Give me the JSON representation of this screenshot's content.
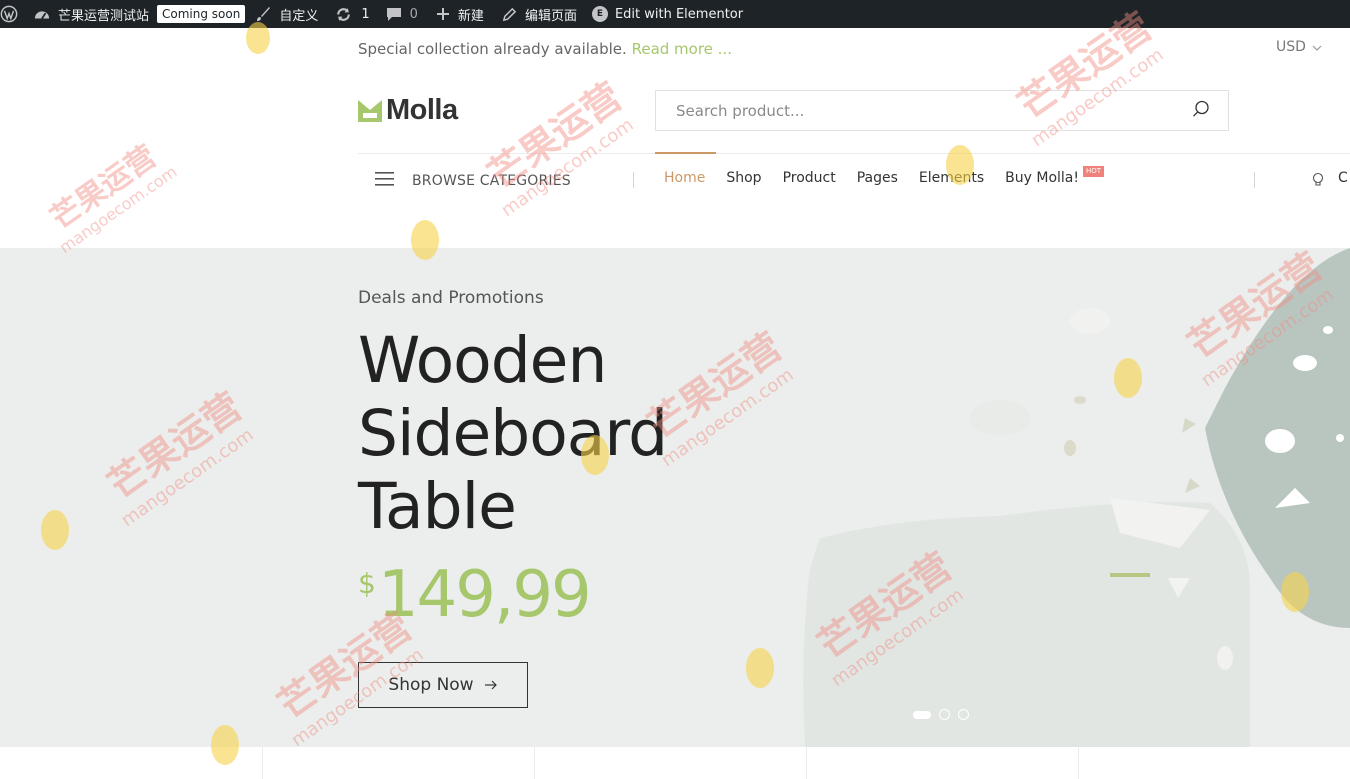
{
  "admin_bar": {
    "site_name": "芒果运营测试站",
    "coming_soon": "Coming soon",
    "customize": "自定义",
    "updates_count": "1",
    "comments_count": "0",
    "new": "新建",
    "edit_page": "编辑页面",
    "edit_elementor": "Edit with Elementor"
  },
  "topbar": {
    "message": "Special collection already available.",
    "read_more": "Read more ...",
    "currency": "USD"
  },
  "header": {
    "logo_text": "Molla",
    "search_placeholder": "Search product..."
  },
  "nav": {
    "browse_label": "BROWSE CATEGORIES",
    "items": [
      {
        "label": "Home",
        "active": true
      },
      {
        "label": "Shop"
      },
      {
        "label": "Product"
      },
      {
        "label": "Pages"
      },
      {
        "label": "Elements"
      },
      {
        "label": "Buy Molla!"
      }
    ],
    "hot_badge": "HOT",
    "right_partial": "C"
  },
  "hero": {
    "subtitle": "Deals and Promotions",
    "title_lines": [
      "Wooden",
      "Sideboard",
      "Table"
    ],
    "price_currency": "$",
    "price_amount": "149,99",
    "cta": "Shop Now",
    "slide_count": 3,
    "active_slide": 1
  },
  "watermark": {
    "chinese": "芒果运营",
    "domain": "mangoecom.com"
  },
  "colors": {
    "accent": "#c96",
    "green": "#a6c76c",
    "admin_bg": "#1d2327",
    "hero_bg": "#ebeeec"
  }
}
